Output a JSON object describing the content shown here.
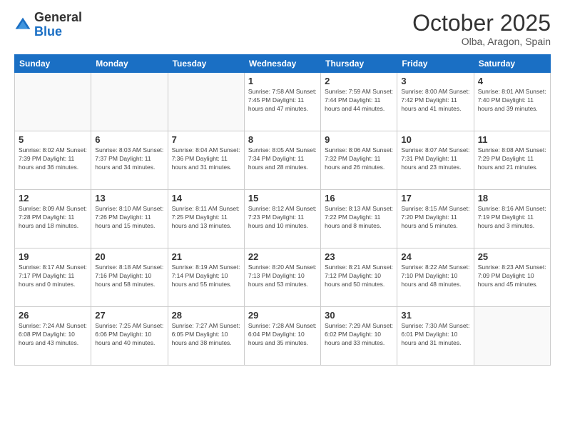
{
  "logo": {
    "general": "General",
    "blue": "Blue"
  },
  "header": {
    "month": "October 2025",
    "location": "Olba, Aragon, Spain"
  },
  "weekdays": [
    "Sunday",
    "Monday",
    "Tuesday",
    "Wednesday",
    "Thursday",
    "Friday",
    "Saturday"
  ],
  "weeks": [
    [
      {
        "day": "",
        "info": ""
      },
      {
        "day": "",
        "info": ""
      },
      {
        "day": "",
        "info": ""
      },
      {
        "day": "1",
        "info": "Sunrise: 7:58 AM\nSunset: 7:45 PM\nDaylight: 11 hours\nand 47 minutes."
      },
      {
        "day": "2",
        "info": "Sunrise: 7:59 AM\nSunset: 7:44 PM\nDaylight: 11 hours\nand 44 minutes."
      },
      {
        "day": "3",
        "info": "Sunrise: 8:00 AM\nSunset: 7:42 PM\nDaylight: 11 hours\nand 41 minutes."
      },
      {
        "day": "4",
        "info": "Sunrise: 8:01 AM\nSunset: 7:40 PM\nDaylight: 11 hours\nand 39 minutes."
      }
    ],
    [
      {
        "day": "5",
        "info": "Sunrise: 8:02 AM\nSunset: 7:39 PM\nDaylight: 11 hours\nand 36 minutes."
      },
      {
        "day": "6",
        "info": "Sunrise: 8:03 AM\nSunset: 7:37 PM\nDaylight: 11 hours\nand 34 minutes."
      },
      {
        "day": "7",
        "info": "Sunrise: 8:04 AM\nSunset: 7:36 PM\nDaylight: 11 hours\nand 31 minutes."
      },
      {
        "day": "8",
        "info": "Sunrise: 8:05 AM\nSunset: 7:34 PM\nDaylight: 11 hours\nand 28 minutes."
      },
      {
        "day": "9",
        "info": "Sunrise: 8:06 AM\nSunset: 7:32 PM\nDaylight: 11 hours\nand 26 minutes."
      },
      {
        "day": "10",
        "info": "Sunrise: 8:07 AM\nSunset: 7:31 PM\nDaylight: 11 hours\nand 23 minutes."
      },
      {
        "day": "11",
        "info": "Sunrise: 8:08 AM\nSunset: 7:29 PM\nDaylight: 11 hours\nand 21 minutes."
      }
    ],
    [
      {
        "day": "12",
        "info": "Sunrise: 8:09 AM\nSunset: 7:28 PM\nDaylight: 11 hours\nand 18 minutes."
      },
      {
        "day": "13",
        "info": "Sunrise: 8:10 AM\nSunset: 7:26 PM\nDaylight: 11 hours\nand 15 minutes."
      },
      {
        "day": "14",
        "info": "Sunrise: 8:11 AM\nSunset: 7:25 PM\nDaylight: 11 hours\nand 13 minutes."
      },
      {
        "day": "15",
        "info": "Sunrise: 8:12 AM\nSunset: 7:23 PM\nDaylight: 11 hours\nand 10 minutes."
      },
      {
        "day": "16",
        "info": "Sunrise: 8:13 AM\nSunset: 7:22 PM\nDaylight: 11 hours\nand 8 minutes."
      },
      {
        "day": "17",
        "info": "Sunrise: 8:15 AM\nSunset: 7:20 PM\nDaylight: 11 hours\nand 5 minutes."
      },
      {
        "day": "18",
        "info": "Sunrise: 8:16 AM\nSunset: 7:19 PM\nDaylight: 11 hours\nand 3 minutes."
      }
    ],
    [
      {
        "day": "19",
        "info": "Sunrise: 8:17 AM\nSunset: 7:17 PM\nDaylight: 11 hours\nand 0 minutes."
      },
      {
        "day": "20",
        "info": "Sunrise: 8:18 AM\nSunset: 7:16 PM\nDaylight: 10 hours\nand 58 minutes."
      },
      {
        "day": "21",
        "info": "Sunrise: 8:19 AM\nSunset: 7:14 PM\nDaylight: 10 hours\nand 55 minutes."
      },
      {
        "day": "22",
        "info": "Sunrise: 8:20 AM\nSunset: 7:13 PM\nDaylight: 10 hours\nand 53 minutes."
      },
      {
        "day": "23",
        "info": "Sunrise: 8:21 AM\nSunset: 7:12 PM\nDaylight: 10 hours\nand 50 minutes."
      },
      {
        "day": "24",
        "info": "Sunrise: 8:22 AM\nSunset: 7:10 PM\nDaylight: 10 hours\nand 48 minutes."
      },
      {
        "day": "25",
        "info": "Sunrise: 8:23 AM\nSunset: 7:09 PM\nDaylight: 10 hours\nand 45 minutes."
      }
    ],
    [
      {
        "day": "26",
        "info": "Sunrise: 7:24 AM\nSunset: 6:08 PM\nDaylight: 10 hours\nand 43 minutes."
      },
      {
        "day": "27",
        "info": "Sunrise: 7:25 AM\nSunset: 6:06 PM\nDaylight: 10 hours\nand 40 minutes."
      },
      {
        "day": "28",
        "info": "Sunrise: 7:27 AM\nSunset: 6:05 PM\nDaylight: 10 hours\nand 38 minutes."
      },
      {
        "day": "29",
        "info": "Sunrise: 7:28 AM\nSunset: 6:04 PM\nDaylight: 10 hours\nand 35 minutes."
      },
      {
        "day": "30",
        "info": "Sunrise: 7:29 AM\nSunset: 6:02 PM\nDaylight: 10 hours\nand 33 minutes."
      },
      {
        "day": "31",
        "info": "Sunrise: 7:30 AM\nSunset: 6:01 PM\nDaylight: 10 hours\nand 31 minutes."
      },
      {
        "day": "",
        "info": ""
      }
    ]
  ],
  "colors": {
    "header_bg": "#1a6fc4",
    "row_shade": "#f5f5f5"
  }
}
